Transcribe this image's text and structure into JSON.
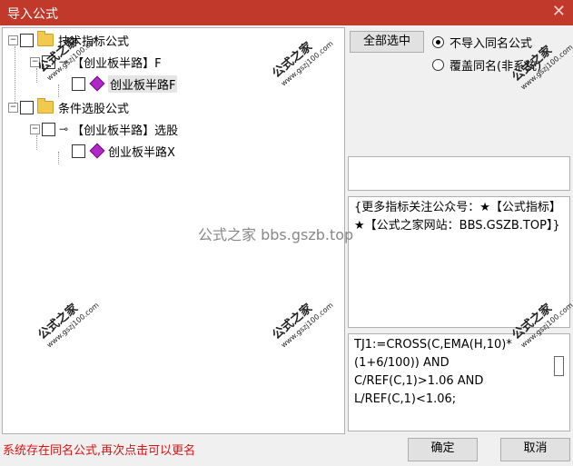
{
  "window": {
    "title": "导入公式",
    "close_icon": "close-icon"
  },
  "tree": {
    "group1": {
      "label": "技术指标公式"
    },
    "item1": {
      "label": "【创业板半路】F"
    },
    "item1_child": {
      "label": "创业板半路F"
    },
    "group2": {
      "label": "条件选股公式"
    },
    "item2": {
      "label": "【创业板半路】选股"
    },
    "item2_child": {
      "label": "创业板半路X"
    }
  },
  "select_all": {
    "label": "全部选中"
  },
  "options": {
    "no_import": "不导入同名公式",
    "overwrite": "覆盖同名(非系统)"
  },
  "description": "{更多指标关注公众号：★【公式指标】★【公式之家网站：BBS.GSZB.TOP】}",
  "formula": "TJ1:=CROSS(C,EMA(H,10)*(1+6/100)) AND C/REF(C,1)>1.06 AND L/REF(C,1)<1.06;",
  "status": "系统存在同名公式,再次点击可以更名",
  "buttons": {
    "ok": "确定",
    "cancel": "取消"
  },
  "watermark": {
    "brand": "公式之家",
    "site": "www.gszj100.com",
    "center_text": "公式之家 bbs.gszb.top"
  },
  "colors": {
    "titlebar": "#c0392b",
    "status": "#e01010"
  }
}
